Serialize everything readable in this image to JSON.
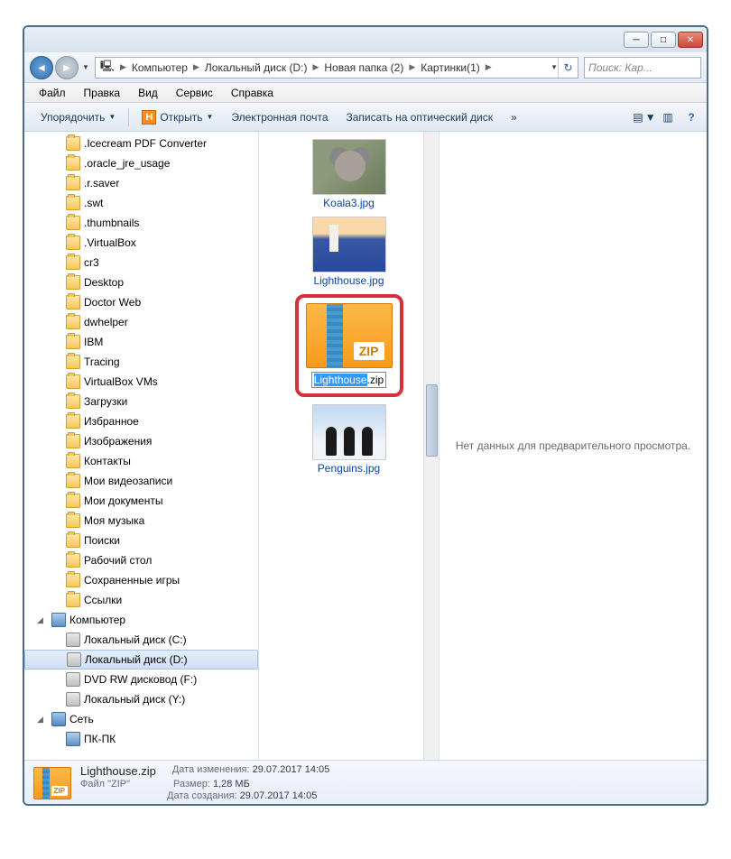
{
  "window": {
    "minimize": "─",
    "maximize": "□",
    "close": "✕"
  },
  "breadcrumb": {
    "root_icon": "🖳",
    "items": [
      "Компьютер",
      "Локальный диск (D:)",
      "Новая папка (2)",
      "Картинки(1)"
    ]
  },
  "search": {
    "placeholder": "Поиск: Кар..."
  },
  "menu": {
    "file": "Файл",
    "edit": "Правка",
    "view": "Вид",
    "tools": "Сервис",
    "help": "Справка"
  },
  "toolbar": {
    "organize": "Упорядочить",
    "open": "Открыть",
    "email": "Электронная почта",
    "burn": "Записать на оптический диск",
    "more": "»"
  },
  "tree": {
    "items": [
      {
        "label": ".Icecream PDF Converter",
        "icon": "folder"
      },
      {
        "label": ".oracle_jre_usage",
        "icon": "folder"
      },
      {
        "label": ".r.saver",
        "icon": "folder"
      },
      {
        "label": ".swt",
        "icon": "folder"
      },
      {
        "label": ".thumbnails",
        "icon": "folder"
      },
      {
        "label": ".VirtualBox",
        "icon": "folder"
      },
      {
        "label": "cr3",
        "icon": "folder"
      },
      {
        "label": "Desktop",
        "icon": "folder"
      },
      {
        "label": "Doctor Web",
        "icon": "folder"
      },
      {
        "label": "dwhelper",
        "icon": "folder"
      },
      {
        "label": "IBM",
        "icon": "folder"
      },
      {
        "label": "Tracing",
        "icon": "folder"
      },
      {
        "label": "VirtualBox VMs",
        "icon": "folder"
      },
      {
        "label": "Загрузки",
        "icon": "folder"
      },
      {
        "label": "Избранное",
        "icon": "folder"
      },
      {
        "label": "Изображения",
        "icon": "folder"
      },
      {
        "label": "Контакты",
        "icon": "folder"
      },
      {
        "label": "Мои видеозаписи",
        "icon": "folder"
      },
      {
        "label": "Мои документы",
        "icon": "folder"
      },
      {
        "label": "Моя музыка",
        "icon": "folder"
      },
      {
        "label": "Поиски",
        "icon": "folder"
      },
      {
        "label": "Рабочий стол",
        "icon": "folder"
      },
      {
        "label": "Сохраненные игры",
        "icon": "folder"
      },
      {
        "label": "Ссылки",
        "icon": "folder"
      }
    ],
    "computer": "Компьютер",
    "drives": [
      {
        "label": "Локальный диск (C:)"
      },
      {
        "label": "Локальный диск (D:)",
        "selected": true
      },
      {
        "label": "DVD RW дисковод (F:)"
      },
      {
        "label": "Локальный диск (Y:)"
      }
    ],
    "network": "Сеть",
    "pc": "ПК-ПК"
  },
  "files": {
    "koala": "Koala3.jpg",
    "lighthouse_jpg": "Lighthouse.jpg",
    "lighthouse_zip_name": "Lighthouse",
    "lighthouse_zip_ext": ".zip",
    "penguins": "Penguins.jpg"
  },
  "preview": {
    "empty": "Нет данных для предварительного просмотра."
  },
  "status": {
    "filename": "Lighthouse.zip",
    "filetype": "Файл \"ZIP\"",
    "modified_label": "Дата изменения:",
    "modified": "29.07.2017 14:05",
    "size_label": "Размер:",
    "size": "1,28 МБ",
    "created_label": "Дата создания:",
    "created": "29.07.2017 14:05"
  }
}
